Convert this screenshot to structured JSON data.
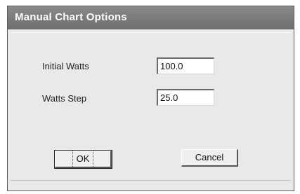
{
  "dialog": {
    "title": "Manual Chart Options",
    "fields": [
      {
        "label": "Initial Watts",
        "value": "100.0"
      },
      {
        "label": "Watts Step",
        "value": "25.0"
      }
    ],
    "buttons": {
      "ok": "OK",
      "cancel": "Cancel"
    }
  }
}
